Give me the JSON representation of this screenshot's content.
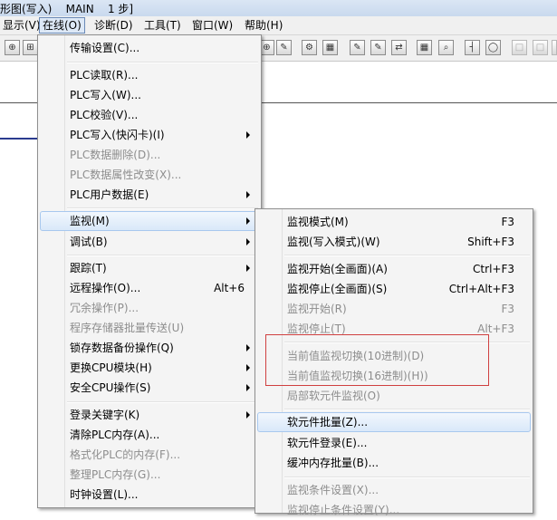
{
  "title": {
    "text": "形图(写入)    MAIN    1 步]"
  },
  "menubar": {
    "items": [
      {
        "label": "显示(V)"
      },
      {
        "label": "在线(O)"
      },
      {
        "label": "诊断(D)"
      },
      {
        "label": "工具(T)"
      },
      {
        "label": "窗口(W)"
      },
      {
        "label": "帮助(H)"
      }
    ]
  },
  "toolbar": {
    "icons": [
      "zoom-icon",
      "ladder-icon",
      "monitor-icon",
      "write-icon",
      "settings-icon",
      "grid-icon",
      "edit-icon",
      "edit2-icon",
      "transfer-icon",
      "network-icon",
      "search-icon",
      "contact-icon",
      "coil-icon",
      "box-icon",
      "box2-icon",
      "box3-icon"
    ]
  },
  "online_menu": {
    "items": [
      {
        "label": "传输设置(C)...",
        "shortcut": "",
        "disabled": false,
        "submenu": false
      },
      {
        "label": "PLC读取(R)...",
        "shortcut": "",
        "disabled": false,
        "submenu": false
      },
      {
        "label": "PLC写入(W)...",
        "shortcut": "",
        "disabled": false,
        "submenu": false
      },
      {
        "label": "PLC校验(V)...",
        "shortcut": "",
        "disabled": false,
        "submenu": false
      },
      {
        "label": "PLC写入(快闪卡)(I)",
        "shortcut": "",
        "disabled": false,
        "submenu": true
      },
      {
        "label": "PLC数据删除(D)...",
        "shortcut": "",
        "disabled": true,
        "submenu": false
      },
      {
        "label": "PLC数据属性改变(X)...",
        "shortcut": "",
        "disabled": true,
        "submenu": false
      },
      {
        "label": "PLC用户数据(E)",
        "shortcut": "",
        "disabled": false,
        "submenu": true
      },
      {
        "label": "监视(M)",
        "shortcut": "",
        "disabled": false,
        "submenu": true,
        "highlight": true
      },
      {
        "label": "调试(B)",
        "shortcut": "",
        "disabled": false,
        "submenu": true
      },
      {
        "label": "跟踪(T)",
        "shortcut": "",
        "disabled": false,
        "submenu": true
      },
      {
        "label": "远程操作(O)...",
        "shortcut": "Alt+6",
        "disabled": false,
        "submenu": false
      },
      {
        "label": "冗余操作(P)...",
        "shortcut": "",
        "disabled": true,
        "submenu": false
      },
      {
        "label": "程序存储器批量传送(U)",
        "shortcut": "",
        "disabled": true,
        "submenu": false
      },
      {
        "label": "锁存数据备份操作(Q)",
        "shortcut": "",
        "disabled": false,
        "submenu": true
      },
      {
        "label": "更换CPU模块(H)",
        "shortcut": "",
        "disabled": false,
        "submenu": true
      },
      {
        "label": "安全CPU操作(S)",
        "shortcut": "",
        "disabled": false,
        "submenu": true
      },
      {
        "label": "登录关键字(K)",
        "shortcut": "",
        "disabled": false,
        "submenu": true
      },
      {
        "label": "清除PLC内存(A)...",
        "shortcut": "",
        "disabled": false,
        "submenu": false
      },
      {
        "label": "格式化PLC的内存(F)...",
        "shortcut": "",
        "disabled": true,
        "submenu": false
      },
      {
        "label": "整理PLC内存(G)...",
        "shortcut": "",
        "disabled": true,
        "submenu": false
      },
      {
        "label": "时钟设置(L)...",
        "shortcut": "",
        "disabled": false,
        "submenu": false
      }
    ]
  },
  "monitor_menu": {
    "items": [
      {
        "label": "监视模式(M)",
        "shortcut": "F3",
        "disabled": false
      },
      {
        "label": "监视(写入模式)(W)",
        "shortcut": "Shift+F3",
        "disabled": false
      },
      {
        "label": "监视开始(全画面)(A)",
        "shortcut": "Ctrl+F3",
        "disabled": false
      },
      {
        "label": "监视停止(全画面)(S)",
        "shortcut": "Ctrl+Alt+F3",
        "disabled": false
      },
      {
        "label": "监视开始(R)",
        "shortcut": "F3",
        "disabled": true
      },
      {
        "label": "监视停止(T)",
        "shortcut": "Alt+F3",
        "disabled": true
      },
      {
        "label": "当前值监视切换(10进制)(D)",
        "shortcut": "",
        "disabled": true
      },
      {
        "label": "当前值监视切换(16进制)(H))",
        "shortcut": "",
        "disabled": true
      },
      {
        "label": "局部软元件监视(O)",
        "shortcut": "",
        "disabled": true
      },
      {
        "label": "软元件批量(Z)...",
        "shortcut": "",
        "disabled": false,
        "highlight": true
      },
      {
        "label": "软元件登录(E)...",
        "shortcut": "",
        "disabled": false
      },
      {
        "label": "缓冲内存批量(B)...",
        "shortcut": "",
        "disabled": false
      },
      {
        "label": "监视条件设置(X)...",
        "shortcut": "",
        "disabled": true
      },
      {
        "label": "监视停止条件设置(Y)...",
        "shortcut": "",
        "disabled": true
      }
    ]
  }
}
